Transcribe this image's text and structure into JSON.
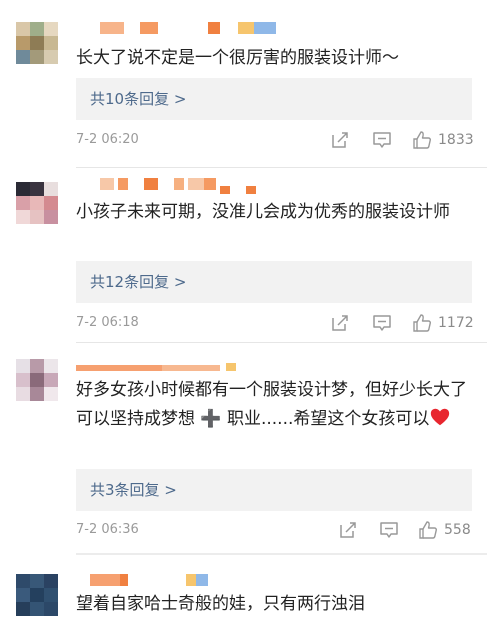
{
  "comments": [
    {
      "text": "长大了说不定是一个很厉害的服装设计师～",
      "reply_label": "共10条回复 >",
      "time": "7-2 06:20",
      "likes": "1833"
    },
    {
      "text": "小孩子未来可期，没准儿会成为优秀的服装设计师",
      "reply_label": "共12条回复 >",
      "time": "7-2 06:18",
      "likes": "1172"
    },
    {
      "text": "好多女孩小时候都有一个服装设计梦，但好少长大了可以坚持成梦想 ➕ 职业......希望这个女孩可以",
      "reply_label": "共3条回复 >",
      "time": "7-2 06:36",
      "likes": "558"
    },
    {
      "text": "望着自家哈士奇般的娃，只有两行浊泪"
    }
  ],
  "icons": {
    "share": "share-icon",
    "comment": "comment-icon",
    "like": "thumbs-up-icon",
    "heart": "heart-emoji-icon"
  },
  "colors": {
    "reply_link": "#4e6a8c",
    "reply_bg": "#f2f2f2",
    "heart": "#e8262f"
  }
}
